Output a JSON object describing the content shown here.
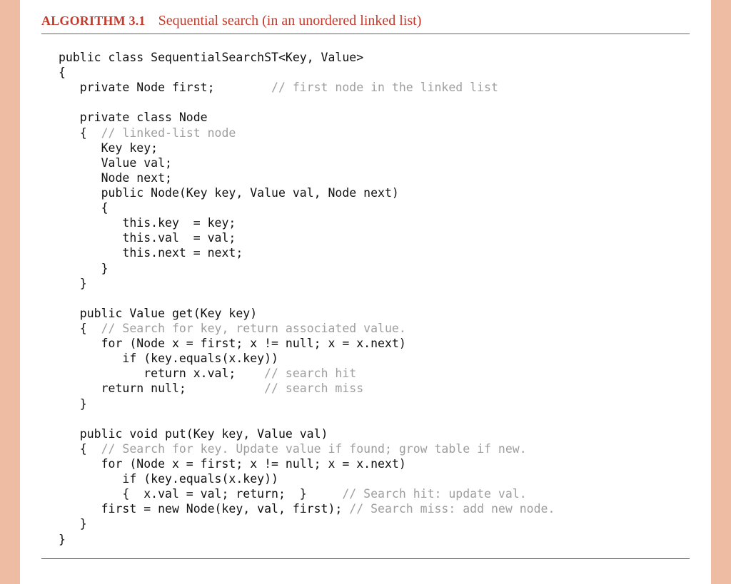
{
  "header": {
    "label": "ALGORITHM 3.1",
    "title": "Sequential search (in an unordered linked list)"
  },
  "code": {
    "L01": "public class SequentialSearchST<Key, Value>",
    "L02": "{",
    "L03": "   private Node first;        ",
    "C03": "// first node in the linked list",
    "L05": "   private class Node",
    "L06a": "   {  ",
    "C06": "// linked-list node",
    "L07": "      Key key;",
    "L08": "      Value val;",
    "L09": "      Node next;",
    "L10": "      public Node(Key key, Value val, Node next)",
    "L11": "      {",
    "L12": "         this.key  = key;",
    "L13": "         this.val  = val;",
    "L14": "         this.next = next;",
    "L15": "      }",
    "L16": "   }",
    "L18": "   public Value get(Key key)",
    "L19a": "   {  ",
    "C19": "// Search for key, return associated value.",
    "L20": "      for (Node x = first; x != null; x = x.next)",
    "L21": "         if (key.equals(x.key))",
    "L22a": "            return x.val;    ",
    "C22": "// search hit",
    "L23a": "      return null;           ",
    "C23": "// search miss",
    "L24": "   }",
    "L26": "   public void put(Key key, Value val)",
    "L27a": "   {  ",
    "C27": "// Search for key. Update value if found; grow table if new.",
    "L28": "      for (Node x = first; x != null; x = x.next)",
    "L29": "         if (key.equals(x.key))",
    "L30a": "         {  x.val = val; return;  }     ",
    "C30": "// Search hit: update val.",
    "L31a": "      first = new Node(key, val, first); ",
    "C31": "// Search miss: add new node.",
    "L32": "   }",
    "L33": "}"
  }
}
